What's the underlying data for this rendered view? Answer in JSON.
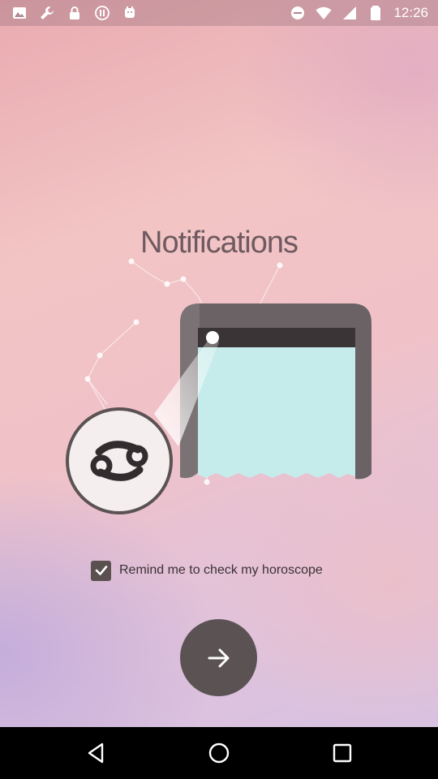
{
  "status_bar": {
    "time": "12:26",
    "left_icons": [
      "image-icon",
      "wrench-icon",
      "lock-icon",
      "pause-icon",
      "android-icon"
    ],
    "right_icons": [
      "do-not-disturb-icon",
      "wifi-icon",
      "signal-icon",
      "battery-icon"
    ]
  },
  "main": {
    "title": "Notifications",
    "zodiac_sign": "cancer",
    "remind_checkbox": {
      "label": "Remind me to check my horoscope",
      "checked": true
    },
    "next_button_icon": "arrow-right-icon"
  },
  "nav_bar": {
    "buttons": [
      "back-icon",
      "home-icon",
      "recents-icon"
    ]
  },
  "colors": {
    "button": "#5b5254",
    "title_text": "#6e5a60",
    "phone_screen": "#c5ebea",
    "phone_frame": "#6a6264"
  }
}
